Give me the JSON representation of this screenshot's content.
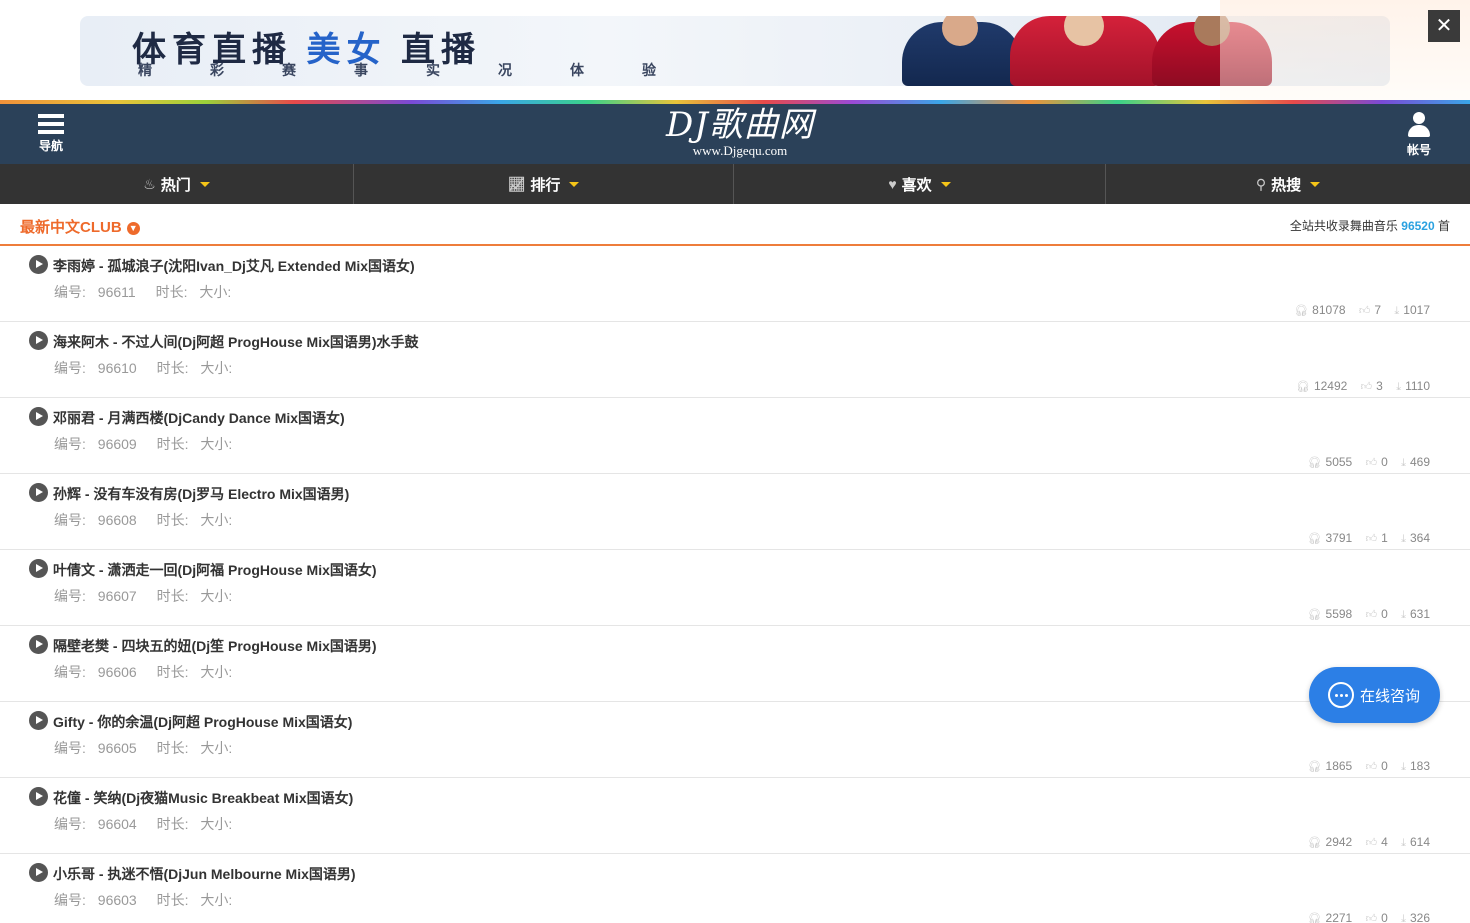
{
  "ad": {
    "title_part1": "体育直播",
    "title_part2": "美女",
    "title_part3": "直播",
    "subtitle": "精彩赛事实况体验",
    "close_label": "✕"
  },
  "header": {
    "nav_label": "导航",
    "account_label": "帐号",
    "logo_main": "DJ歌曲网",
    "logo_sub": "www.Djgequ.com"
  },
  "tabs": [
    {
      "label": "热门",
      "icon": "fire-icon"
    },
    {
      "label": "排行",
      "icon": "chart-icon"
    },
    {
      "label": "喜欢",
      "icon": "heart-icon"
    },
    {
      "label": "热搜",
      "icon": "search-icon"
    }
  ],
  "section": {
    "title": "最新中文CLUB",
    "count_prefix": "全站共收录舞曲音乐",
    "count": "96520",
    "count_suffix": "首"
  },
  "meta_labels": {
    "id": "编号:",
    "duration": "时长:",
    "size": "大小:"
  },
  "songs": [
    {
      "title": "李雨婷 - 孤城浪子(沈阳Ivan_Dj艾凡 Extended Mix国语女)",
      "id": "96611",
      "plays": "81078",
      "likes": "7",
      "downloads": "1017"
    },
    {
      "title": "海来阿木 - 不过人间(Dj阿超 ProgHouse Mix国语男)水手鼓",
      "id": "96610",
      "plays": "12492",
      "likes": "3",
      "downloads": "1110"
    },
    {
      "title": "邓丽君 - 月满西楼(DjCandy Dance Mix国语女)",
      "id": "96609",
      "plays": "5055",
      "likes": "0",
      "downloads": "469"
    },
    {
      "title": "孙辉 - 没有车没有房(Dj罗马 Electro Mix国语男)",
      "id": "96608",
      "plays": "3791",
      "likes": "1",
      "downloads": "364"
    },
    {
      "title": "叶倩文 - 潇洒走一回(Dj阿福 ProgHouse Mix国语女)",
      "id": "96607",
      "plays": "5598",
      "likes": "0",
      "downloads": "631"
    },
    {
      "title": "隔壁老樊 - 四块五的妞(Dj笙 ProgHouse Mix国语男)",
      "id": "96606",
      "plays": "",
      "likes": "",
      "downloads": ""
    },
    {
      "title": "Gifty - 你的余温(Dj阿超 ProgHouse Mix国语女)",
      "id": "96605",
      "plays": "1865",
      "likes": "0",
      "downloads": "183"
    },
    {
      "title": "花僮 - 笑纳(Dj夜猫Music Breakbeat Mix国语女)",
      "id": "96604",
      "plays": "2942",
      "likes": "4",
      "downloads": "614"
    },
    {
      "title": "小乐哥 - 执迷不悟(DjJun Melbourne Mix国语男)",
      "id": "96603",
      "plays": "2271",
      "likes": "0",
      "downloads": "326"
    }
  ],
  "chat": {
    "label": "在线咨询"
  }
}
